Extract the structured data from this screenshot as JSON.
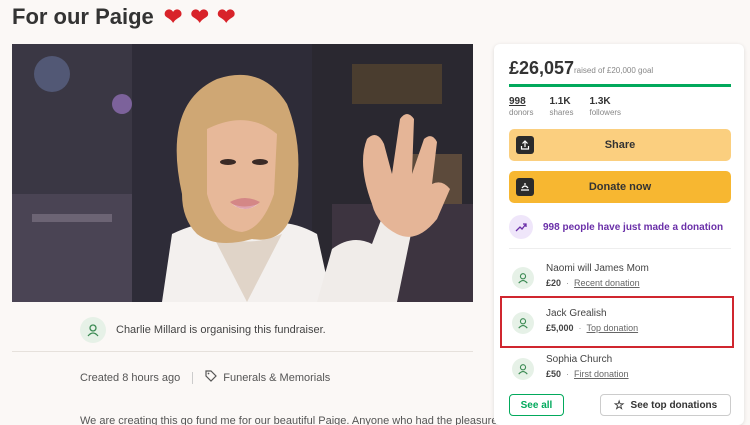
{
  "page": {
    "title": "For our Paige",
    "title_hearts": "❤ ❤ ❤"
  },
  "organiser": {
    "text": "Charlie Millard is organising this fundraiser."
  },
  "meta": {
    "created": "Created 8 hours ago",
    "category": "Funerals & Memorials",
    "teaser": "We are creating this go fund me for our beautiful Paige. Anyone who had the pleasure"
  },
  "fundraiser": {
    "raised": "£26,057",
    "goal_text": "raised of £20,000 goal",
    "progress_fraction": 1.0,
    "stats": [
      {
        "value": "998",
        "label": "donors"
      },
      {
        "value": "1.1K",
        "label": "shares"
      },
      {
        "value": "1.3K",
        "label": "followers"
      }
    ],
    "share_label": "Share",
    "donate_label": "Donate now",
    "recent_text": "998 people have just made a donation",
    "donations": [
      {
        "name": "Naomi will James Mom",
        "amount": "£20",
        "tag": "Recent donation"
      },
      {
        "name": "Jack Grealish",
        "amount": "£5,000",
        "tag": "Top donation"
      },
      {
        "name": "Sophia Church",
        "amount": "£50",
        "tag": "First donation"
      }
    ],
    "see_all_label": "See all",
    "see_top_label": "See top donations"
  },
  "colors": {
    "brand_green": "#02a95c",
    "donate_yellow": "#f7b731",
    "share_yellow": "#fbcf7f",
    "highlight_red": "#d0262f",
    "recent_purple": "#6a2fa8"
  },
  "icons": {
    "heart": "heart-icon",
    "person": "user-icon",
    "tag": "tag-icon",
    "share": "share-icon",
    "donate": "donate-icon",
    "trend": "trend-up-icon",
    "star": "star-icon"
  }
}
